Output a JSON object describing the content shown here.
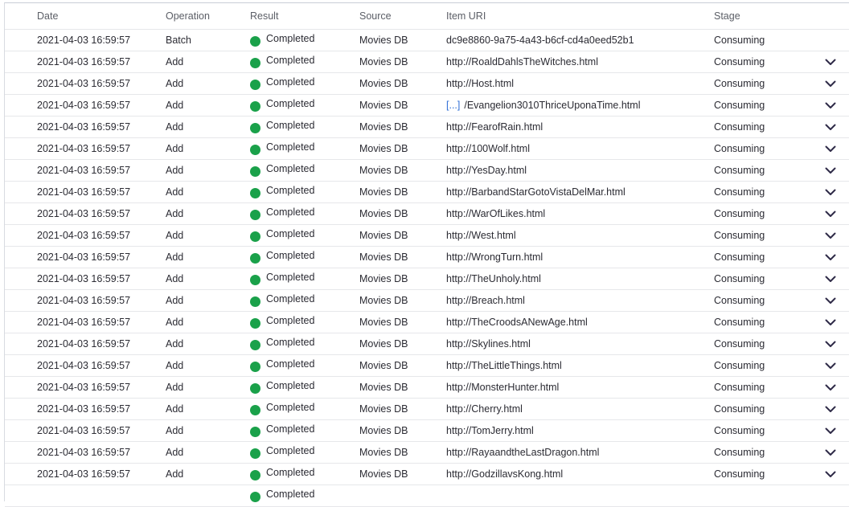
{
  "colors": {
    "status_completed": "#1aa14a",
    "link_accent": "#2f6fd6",
    "chevron": "#2e2a47"
  },
  "columns": {
    "date": "Date",
    "operation": "Operation",
    "result": "Result",
    "source": "Source",
    "item_uri": "Item URI",
    "stage": "Stage"
  },
  "rows": [
    {
      "date": "2021-04-03 16:59:57",
      "operation": "Batch",
      "result": "Completed",
      "source": "Movies DB",
      "uri_prefix": "",
      "item_uri": "dc9e8860-9a75-4a43-b6cf-cd4a0eed52b1",
      "stage": "Consuming",
      "expandable": false
    },
    {
      "date": "2021-04-03 16:59:57",
      "operation": "Add",
      "result": "Completed",
      "source": "Movies DB",
      "uri_prefix": "",
      "item_uri": "http://RoaldDahlsTheWitches.html",
      "stage": "Consuming",
      "expandable": true
    },
    {
      "date": "2021-04-03 16:59:57",
      "operation": "Add",
      "result": "Completed",
      "source": "Movies DB",
      "uri_prefix": "",
      "item_uri": "http://Host.html",
      "stage": "Consuming",
      "expandable": true
    },
    {
      "date": "2021-04-03 16:59:57",
      "operation": "Add",
      "result": "Completed",
      "source": "Movies DB",
      "uri_prefix": "[...]",
      "item_uri": "/Evangelion3010ThriceUponaTime.html",
      "stage": "Consuming",
      "expandable": true
    },
    {
      "date": "2021-04-03 16:59:57",
      "operation": "Add",
      "result": "Completed",
      "source": "Movies DB",
      "uri_prefix": "",
      "item_uri": "http://FearofRain.html",
      "stage": "Consuming",
      "expandable": true
    },
    {
      "date": "2021-04-03 16:59:57",
      "operation": "Add",
      "result": "Completed",
      "source": "Movies DB",
      "uri_prefix": "",
      "item_uri": "http://100Wolf.html",
      "stage": "Consuming",
      "expandable": true
    },
    {
      "date": "2021-04-03 16:59:57",
      "operation": "Add",
      "result": "Completed",
      "source": "Movies DB",
      "uri_prefix": "",
      "item_uri": "http://YesDay.html",
      "stage": "Consuming",
      "expandable": true
    },
    {
      "date": "2021-04-03 16:59:57",
      "operation": "Add",
      "result": "Completed",
      "source": "Movies DB",
      "uri_prefix": "",
      "item_uri": "http://BarbandStarGotoVistaDelMar.html",
      "stage": "Consuming",
      "expandable": true
    },
    {
      "date": "2021-04-03 16:59:57",
      "operation": "Add",
      "result": "Completed",
      "source": "Movies DB",
      "uri_prefix": "",
      "item_uri": "http://WarOfLikes.html",
      "stage": "Consuming",
      "expandable": true
    },
    {
      "date": "2021-04-03 16:59:57",
      "operation": "Add",
      "result": "Completed",
      "source": "Movies DB",
      "uri_prefix": "",
      "item_uri": "http://West.html",
      "stage": "Consuming",
      "expandable": true
    },
    {
      "date": "2021-04-03 16:59:57",
      "operation": "Add",
      "result": "Completed",
      "source": "Movies DB",
      "uri_prefix": "",
      "item_uri": "http://WrongTurn.html",
      "stage": "Consuming",
      "expandable": true
    },
    {
      "date": "2021-04-03 16:59:57",
      "operation": "Add",
      "result": "Completed",
      "source": "Movies DB",
      "uri_prefix": "",
      "item_uri": "http://TheUnholy.html",
      "stage": "Consuming",
      "expandable": true
    },
    {
      "date": "2021-04-03 16:59:57",
      "operation": "Add",
      "result": "Completed",
      "source": "Movies DB",
      "uri_prefix": "",
      "item_uri": "http://Breach.html",
      "stage": "Consuming",
      "expandable": true
    },
    {
      "date": "2021-04-03 16:59:57",
      "operation": "Add",
      "result": "Completed",
      "source": "Movies DB",
      "uri_prefix": "",
      "item_uri": "http://TheCroodsANewAge.html",
      "stage": "Consuming",
      "expandable": true
    },
    {
      "date": "2021-04-03 16:59:57",
      "operation": "Add",
      "result": "Completed",
      "source": "Movies DB",
      "uri_prefix": "",
      "item_uri": "http://Skylines.html",
      "stage": "Consuming",
      "expandable": true
    },
    {
      "date": "2021-04-03 16:59:57",
      "operation": "Add",
      "result": "Completed",
      "source": "Movies DB",
      "uri_prefix": "",
      "item_uri": "http://TheLittleThings.html",
      "stage": "Consuming",
      "expandable": true
    },
    {
      "date": "2021-04-03 16:59:57",
      "operation": "Add",
      "result": "Completed",
      "source": "Movies DB",
      "uri_prefix": "",
      "item_uri": "http://MonsterHunter.html",
      "stage": "Consuming",
      "expandable": true
    },
    {
      "date": "2021-04-03 16:59:57",
      "operation": "Add",
      "result": "Completed",
      "source": "Movies DB",
      "uri_prefix": "",
      "item_uri": "http://Cherry.html",
      "stage": "Consuming",
      "expandable": true
    },
    {
      "date": "2021-04-03 16:59:57",
      "operation": "Add",
      "result": "Completed",
      "source": "Movies DB",
      "uri_prefix": "",
      "item_uri": "http://TomJerry.html",
      "stage": "Consuming",
      "expandable": true
    },
    {
      "date": "2021-04-03 16:59:57",
      "operation": "Add",
      "result": "Completed",
      "source": "Movies DB",
      "uri_prefix": "",
      "item_uri": "http://RayaandtheLastDragon.html",
      "stage": "Consuming",
      "expandable": true
    },
    {
      "date": "2021-04-03 16:59:57",
      "operation": "Add",
      "result": "Completed",
      "source": "Movies DB",
      "uri_prefix": "",
      "item_uri": "http://GodzillavsKong.html",
      "stage": "Consuming",
      "expandable": true
    },
    {
      "date": "",
      "operation": "",
      "result": "Completed",
      "source": "",
      "uri_prefix": "",
      "item_uri": "",
      "stage": "",
      "expandable": false
    }
  ]
}
